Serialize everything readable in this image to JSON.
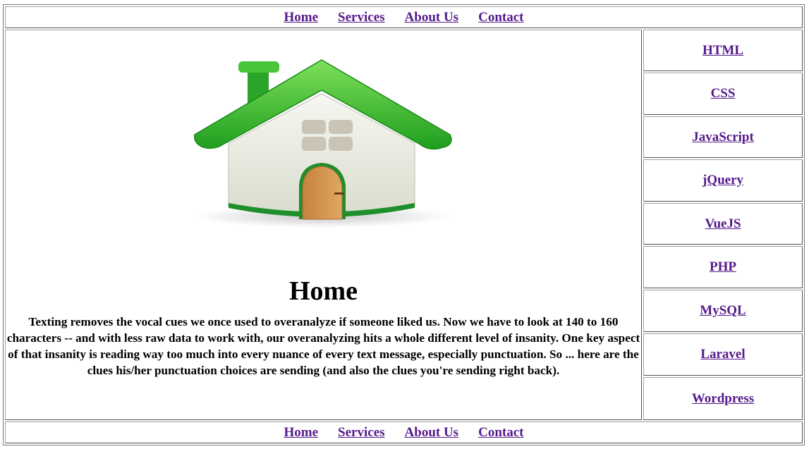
{
  "nav": {
    "items": [
      {
        "label": "Home"
      },
      {
        "label": "Services"
      },
      {
        "label": "About Us"
      },
      {
        "label": "Contact"
      }
    ]
  },
  "main": {
    "image_icon": "house-icon",
    "title": "Home",
    "paragraph": "Texting removes the vocal cues we once used to overanalyze if someone liked us. Now we have to look at 140 to 160 characters -- and with less raw data to work with, our overanalyzing hits a whole different level of insanity. One key aspect of that insanity is reading way too much into every nuance of every text message, especially punctuation. So ... here are the clues his/her punctuation choices are sending (and also the clues you're sending right back)."
  },
  "sidebar": {
    "items": [
      {
        "label": "HTML"
      },
      {
        "label": "CSS"
      },
      {
        "label": "JavaScript"
      },
      {
        "label": "jQuery"
      },
      {
        "label": "VueJS"
      },
      {
        "label": "PHP"
      },
      {
        "label": "MySQL"
      },
      {
        "label": "Laravel"
      },
      {
        "label": "Wordpress"
      }
    ]
  },
  "footer_nav": {
    "items": [
      {
        "label": "Home"
      },
      {
        "label": "Services"
      },
      {
        "label": "About Us"
      },
      {
        "label": "Contact"
      }
    ]
  },
  "colors": {
    "link": "#551a8b",
    "roof_green": "#3cbf2a",
    "door_orange": "#d08a45"
  }
}
